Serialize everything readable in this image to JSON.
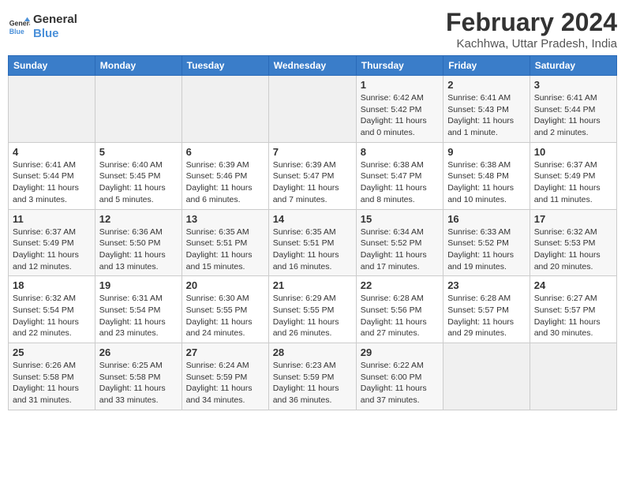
{
  "header": {
    "logo_line1": "General",
    "logo_line2": "Blue",
    "title": "February 2024",
    "subtitle": "Kachhwa, Uttar Pradesh, India"
  },
  "days_of_week": [
    "Sunday",
    "Monday",
    "Tuesday",
    "Wednesday",
    "Thursday",
    "Friday",
    "Saturday"
  ],
  "weeks": [
    [
      {
        "day": "",
        "info": ""
      },
      {
        "day": "",
        "info": ""
      },
      {
        "day": "",
        "info": ""
      },
      {
        "day": "",
        "info": ""
      },
      {
        "day": "1",
        "info": "Sunrise: 6:42 AM\nSunset: 5:42 PM\nDaylight: 11 hours and 0 minutes."
      },
      {
        "day": "2",
        "info": "Sunrise: 6:41 AM\nSunset: 5:43 PM\nDaylight: 11 hours and 1 minute."
      },
      {
        "day": "3",
        "info": "Sunrise: 6:41 AM\nSunset: 5:44 PM\nDaylight: 11 hours and 2 minutes."
      }
    ],
    [
      {
        "day": "4",
        "info": "Sunrise: 6:41 AM\nSunset: 5:44 PM\nDaylight: 11 hours and 3 minutes."
      },
      {
        "day": "5",
        "info": "Sunrise: 6:40 AM\nSunset: 5:45 PM\nDaylight: 11 hours and 5 minutes."
      },
      {
        "day": "6",
        "info": "Sunrise: 6:39 AM\nSunset: 5:46 PM\nDaylight: 11 hours and 6 minutes."
      },
      {
        "day": "7",
        "info": "Sunrise: 6:39 AM\nSunset: 5:47 PM\nDaylight: 11 hours and 7 minutes."
      },
      {
        "day": "8",
        "info": "Sunrise: 6:38 AM\nSunset: 5:47 PM\nDaylight: 11 hours and 8 minutes."
      },
      {
        "day": "9",
        "info": "Sunrise: 6:38 AM\nSunset: 5:48 PM\nDaylight: 11 hours and 10 minutes."
      },
      {
        "day": "10",
        "info": "Sunrise: 6:37 AM\nSunset: 5:49 PM\nDaylight: 11 hours and 11 minutes."
      }
    ],
    [
      {
        "day": "11",
        "info": "Sunrise: 6:37 AM\nSunset: 5:49 PM\nDaylight: 11 hours and 12 minutes."
      },
      {
        "day": "12",
        "info": "Sunrise: 6:36 AM\nSunset: 5:50 PM\nDaylight: 11 hours and 13 minutes."
      },
      {
        "day": "13",
        "info": "Sunrise: 6:35 AM\nSunset: 5:51 PM\nDaylight: 11 hours and 15 minutes."
      },
      {
        "day": "14",
        "info": "Sunrise: 6:35 AM\nSunset: 5:51 PM\nDaylight: 11 hours and 16 minutes."
      },
      {
        "day": "15",
        "info": "Sunrise: 6:34 AM\nSunset: 5:52 PM\nDaylight: 11 hours and 17 minutes."
      },
      {
        "day": "16",
        "info": "Sunrise: 6:33 AM\nSunset: 5:52 PM\nDaylight: 11 hours and 19 minutes."
      },
      {
        "day": "17",
        "info": "Sunrise: 6:32 AM\nSunset: 5:53 PM\nDaylight: 11 hours and 20 minutes."
      }
    ],
    [
      {
        "day": "18",
        "info": "Sunrise: 6:32 AM\nSunset: 5:54 PM\nDaylight: 11 hours and 22 minutes."
      },
      {
        "day": "19",
        "info": "Sunrise: 6:31 AM\nSunset: 5:54 PM\nDaylight: 11 hours and 23 minutes."
      },
      {
        "day": "20",
        "info": "Sunrise: 6:30 AM\nSunset: 5:55 PM\nDaylight: 11 hours and 24 minutes."
      },
      {
        "day": "21",
        "info": "Sunrise: 6:29 AM\nSunset: 5:55 PM\nDaylight: 11 hours and 26 minutes."
      },
      {
        "day": "22",
        "info": "Sunrise: 6:28 AM\nSunset: 5:56 PM\nDaylight: 11 hours and 27 minutes."
      },
      {
        "day": "23",
        "info": "Sunrise: 6:28 AM\nSunset: 5:57 PM\nDaylight: 11 hours and 29 minutes."
      },
      {
        "day": "24",
        "info": "Sunrise: 6:27 AM\nSunset: 5:57 PM\nDaylight: 11 hours and 30 minutes."
      }
    ],
    [
      {
        "day": "25",
        "info": "Sunrise: 6:26 AM\nSunset: 5:58 PM\nDaylight: 11 hours and 31 minutes."
      },
      {
        "day": "26",
        "info": "Sunrise: 6:25 AM\nSunset: 5:58 PM\nDaylight: 11 hours and 33 minutes."
      },
      {
        "day": "27",
        "info": "Sunrise: 6:24 AM\nSunset: 5:59 PM\nDaylight: 11 hours and 34 minutes."
      },
      {
        "day": "28",
        "info": "Sunrise: 6:23 AM\nSunset: 5:59 PM\nDaylight: 11 hours and 36 minutes."
      },
      {
        "day": "29",
        "info": "Sunrise: 6:22 AM\nSunset: 6:00 PM\nDaylight: 11 hours and 37 minutes."
      },
      {
        "day": "",
        "info": ""
      },
      {
        "day": "",
        "info": ""
      }
    ]
  ]
}
